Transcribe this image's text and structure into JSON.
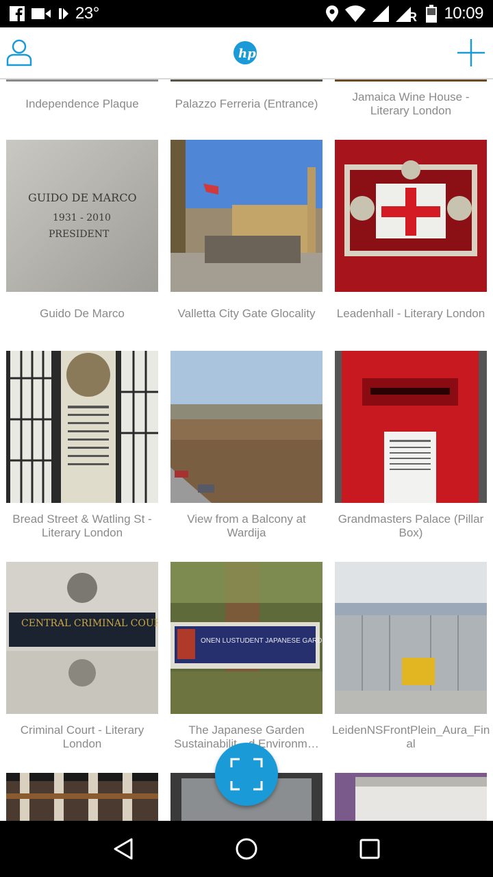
{
  "status_bar": {
    "temperature": "23°",
    "time": "10:09",
    "battery_level": "43",
    "icons": [
      "facebook-icon",
      "video-icon",
      "play-icon",
      "location-icon",
      "wifi-icon",
      "signal-icon",
      "roaming-signal-icon",
      "battery-icon"
    ]
  },
  "app_bar": {
    "logo": "hp",
    "left_icon": "profile-icon",
    "right_icon": "add-icon",
    "accent_color": "#1a9ad6"
  },
  "grid": {
    "top_row": [
      {
        "caption": "Independence Plaque"
      },
      {
        "caption": "Palazzo Ferreria (Entrance)"
      },
      {
        "caption": "Jamaica Wine House -\nLiterary London"
      }
    ],
    "rows": [
      [
        {
          "caption": "Guido De Marco",
          "image": "stone-inscription"
        },
        {
          "caption": "Valletta City Gate Glocality",
          "image": "street-scene"
        },
        {
          "caption": "Leadenhall - Literary London",
          "image": "red-crest-plaque"
        }
      ],
      [
        {
          "caption": "Bread Street & Watling St -\nLiterary London",
          "image": "window-plaque"
        },
        {
          "caption": "View from a Balcony at\nWardija",
          "image": "landscape-view"
        },
        {
          "caption": "Grandmasters Palace (Pillar\nBox)",
          "image": "red-pillar-box"
        }
      ],
      [
        {
          "caption": "Criminal Court - Literary\nLondon",
          "image": "court-sign"
        },
        {
          "caption": "The Japanese Garden\nSustainabilit…d Environm…",
          "image": "garden-sign"
        },
        {
          "caption": "LeidenNSFrontPlein_Aura_Fin\nal",
          "image": "station-front"
        }
      ]
    ]
  },
  "thumb_text": {
    "guido_lines": [
      "GUIDO DE MARCO",
      "1931 - 2010",
      "PRESIDENT"
    ],
    "court_sign": "CENTRAL CRIMINAL COURT",
    "garden_sign": "ONEN LUSTUDENT JAPANESE GARDEN"
  },
  "fab": {
    "icon": "fullscreen-icon"
  },
  "nav_bar": {
    "icons": [
      "back-icon",
      "home-icon",
      "recents-icon"
    ]
  }
}
